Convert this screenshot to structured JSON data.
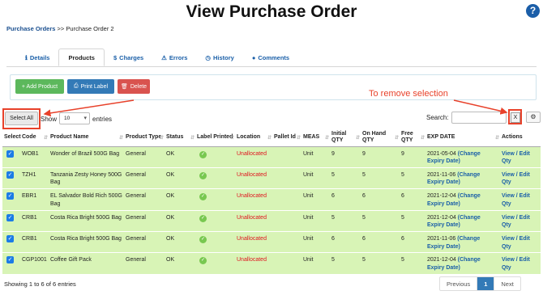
{
  "page": {
    "title": "View Purchase Order",
    "help_icon": "?"
  },
  "breadcrumb": {
    "link": "Purchase Orders",
    "separator": ">>",
    "current": "Purchase Order 2"
  },
  "tabs": [
    {
      "icon": "ℹ",
      "label": "Details"
    },
    {
      "icon": "",
      "label": "Products"
    },
    {
      "icon": "$",
      "label": "Charges"
    },
    {
      "icon": "⚠",
      "label": "Errors"
    },
    {
      "icon": "◷",
      "label": "History"
    },
    {
      "icon": "●",
      "label": "Comments"
    }
  ],
  "actions": {
    "add": "+ Add Product",
    "print": "Print Label",
    "delete": "Delete"
  },
  "annotation": {
    "text": "To remove selection"
  },
  "controls": {
    "select_all": "Select All",
    "show": "Show",
    "page_size": "10",
    "entries": "entries",
    "search": "Search:",
    "clear": "X",
    "gear": "⚙"
  },
  "columns": [
    "Select",
    "Code",
    "Product Name",
    "Product Type",
    "Status",
    "Label Printed",
    "Location",
    "Pallet Id",
    "MEAS",
    "Initial QTY",
    "On Hand QTY",
    "Free QTY",
    "EXP DATE",
    "Actions"
  ],
  "rows": [
    {
      "code": "WOB1",
      "name": "Wonder of Brazil 500G Bag",
      "type": "General",
      "status": "OK",
      "location": "Unallocated",
      "pallet": "",
      "meas": "Unit",
      "initial": "9",
      "onhand": "9",
      "free": "9",
      "exp": "2021-05-04",
      "change": "(Change Expiry Date)",
      "actions": "View / Edit Qty"
    },
    {
      "code": "TZH1",
      "name": "Tanzania Zesty Honey 500G Bag",
      "type": "General",
      "status": "OK",
      "location": "Unallocated",
      "pallet": "",
      "meas": "Unit",
      "initial": "5",
      "onhand": "5",
      "free": "5",
      "exp": "2021-11-06",
      "change": "(Change Expiry Date)",
      "actions": "View / Edit Qty"
    },
    {
      "code": "EBR1",
      "name": "EL Salvador Bold Rich 500G Bag",
      "type": "General",
      "status": "OK",
      "location": "Unallocated",
      "pallet": "",
      "meas": "Unit",
      "initial": "6",
      "onhand": "6",
      "free": "6",
      "exp": "2021-12-04",
      "change": "(Change Expiry Date)",
      "actions": "View / Edit Qty"
    },
    {
      "code": "CRB1",
      "name": "Costa Rica Bright 500G Bag",
      "type": "General",
      "status": "OK",
      "location": "Unallocated",
      "pallet": "",
      "meas": "Unit",
      "initial": "5",
      "onhand": "5",
      "free": "5",
      "exp": "2021-12-04",
      "change": "(Change Expiry Date)",
      "actions": "View / Edit Qty"
    },
    {
      "code": "CRB1",
      "name": "Costa Rica Bright 500G Bag",
      "type": "General",
      "status": "OK",
      "location": "Unallocated",
      "pallet": "",
      "meas": "Unit",
      "initial": "6",
      "onhand": "6",
      "free": "6",
      "exp": "2021-11-06",
      "change": "(Change Expiry Date)",
      "actions": "View / Edit Qty"
    },
    {
      "code": "CGP1001",
      "name": "Coffee Gift Pack",
      "type": "General",
      "status": "OK",
      "location": "Unallocated",
      "pallet": "",
      "meas": "Unit",
      "initial": "5",
      "onhand": "5",
      "free": "5",
      "exp": "2021-12-04",
      "change": "(Change Expiry Date)",
      "actions": "View / Edit Qty"
    }
  ],
  "footer": {
    "info": "Showing 1 to 6 of 6 entries",
    "previous": "Previous",
    "page": "1",
    "next": "Next"
  },
  "colors": {
    "row_bg": "#d8f4b6",
    "unallocated": "#e0141e",
    "annotation": "#e8412a",
    "link": "#1a5fa8"
  }
}
